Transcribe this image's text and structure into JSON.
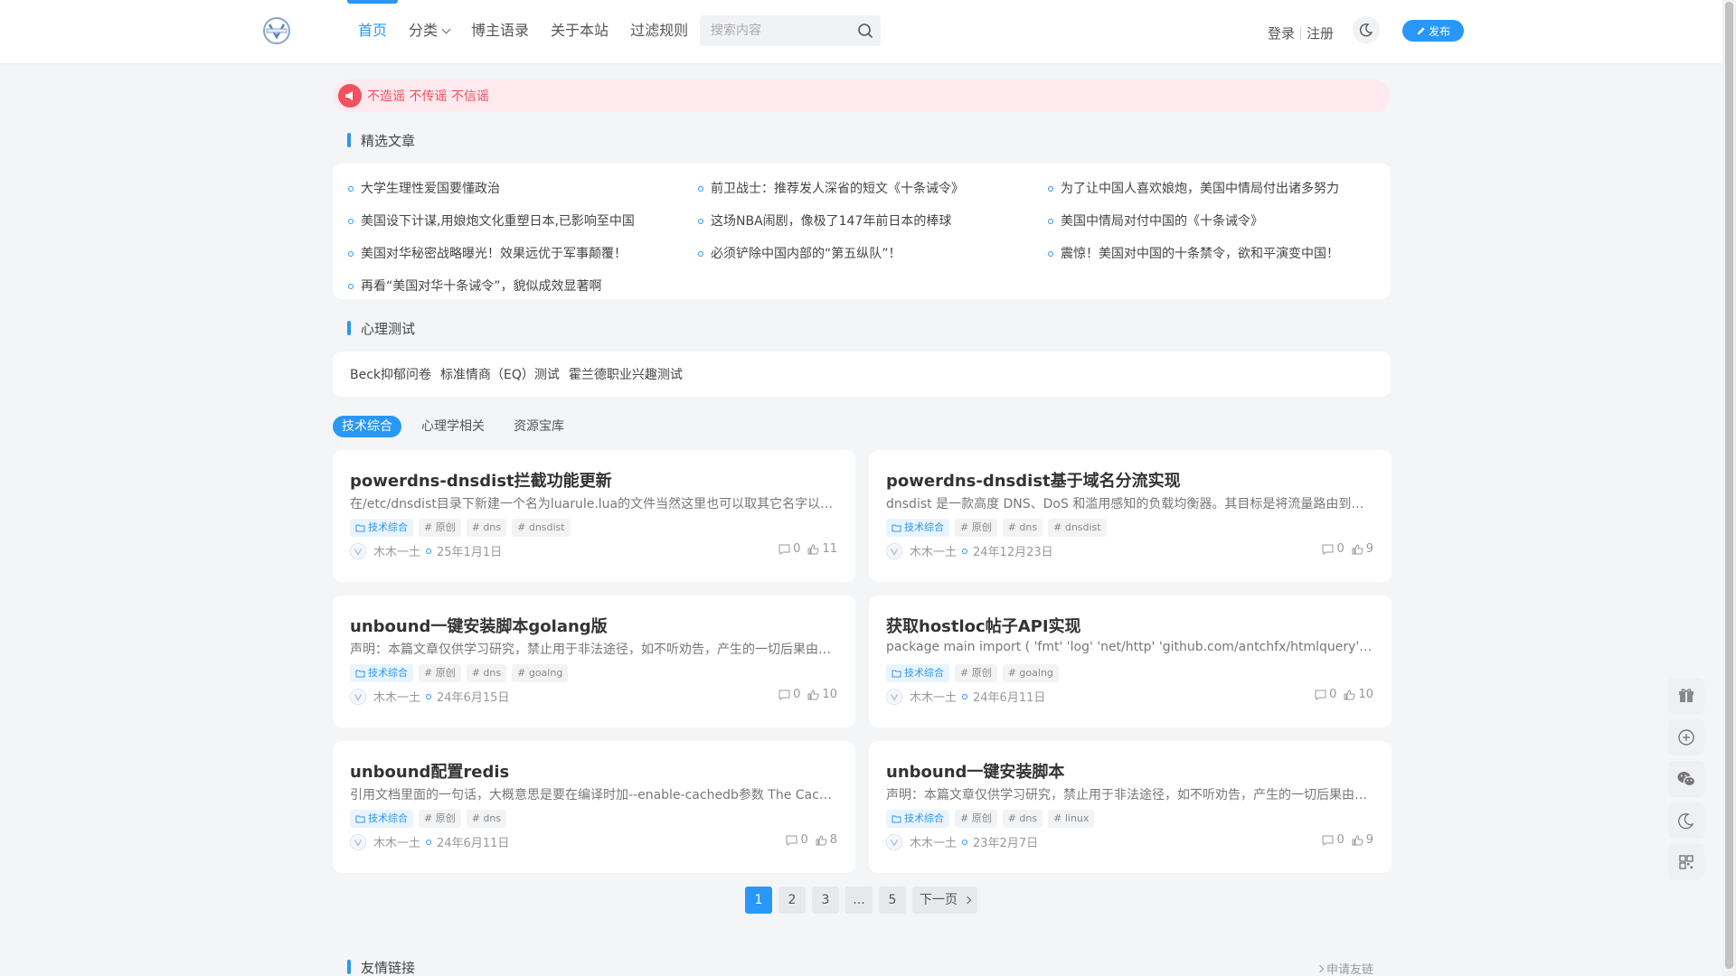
{
  "header": {
    "nav": [
      {
        "label": "首页",
        "active": true
      },
      {
        "label": "分类",
        "dropdown": true
      },
      {
        "label": "博主语录"
      },
      {
        "label": "关于本站"
      },
      {
        "label": "过滤规则"
      }
    ],
    "search_placeholder": "搜索内容",
    "login": "登录",
    "register": "注册",
    "publish": "发布"
  },
  "notice": "不造谣 不传谣 不信谣",
  "featured": {
    "title": "精选文章",
    "items": [
      "大学生理性爱国要懂政治",
      "前卫战士：推荐发人深省的短文《十条诫令》",
      "为了让中国人喜欢娘炮，美国中情局付出诸多努力",
      "美国设下计谋,用娘炮文化重塑日本,已影响至中国",
      "这场NBA闹剧，像极了147年前日本的棒球",
      "美国中情局对付中国的《十条诫令》",
      "美国对华秘密战略曝光！效果远优于军事颠覆！",
      "必须铲除中国内部的“第五纵队”！",
      "震惊！美国对中国的十条禁令，欲和平演变中国！",
      "再看“美国对华十条诫令”，貌似成效显著啊"
    ]
  },
  "psych": {
    "title": "心理测试",
    "links": [
      "Beck抑郁问卷",
      "标准情商（EQ）测试",
      "霍兰德职业兴趣测试"
    ]
  },
  "tabs": [
    {
      "label": "技术综合",
      "active": true
    },
    {
      "label": "心理学相关"
    },
    {
      "label": "资源宝库"
    }
  ],
  "posts": [
    {
      "title": "powerdns-dnsdist拦截功能更新",
      "excerpt": "在/etc/dnsdist目录下新建一个名为luarule.lua的文件当然这里也可以取其它名字以下是对该脚本功能的详细说明",
      "category": "技术综合",
      "tags": [
        "# 原创",
        "# dns",
        "# dnsdist"
      ],
      "author": "木木一土",
      "date": "25年1月1日",
      "comments": "0",
      "likes": "11"
    },
    {
      "title": "powerdns-dnsdist基于域名分流实现",
      "excerpt": "dnsdist 是一款高度 DNS、DoS 和滥用感知的负载均衡器。其目标是将流量路由到最佳服务器",
      "category": "技术综合",
      "tags": [
        "# 原创",
        "# dns",
        "# dnsdist"
      ],
      "author": "木木一土",
      "date": "24年12月23日",
      "comments": "0",
      "likes": "9"
    },
    {
      "title": "unbound一键安装脚本golang版",
      "excerpt": "声明：本篇文章仅供学习研究，禁止用于非法途径，如不听劝告，产生的一切后果由使用者自行承担",
      "category": "技术综合",
      "tags": [
        "# 原创",
        "# dns",
        "# goalng"
      ],
      "author": "木木一土",
      "date": "24年6月15日",
      "comments": "0",
      "likes": "10"
    },
    {
      "title": "获取hostloc帖子API实现",
      "excerpt": "    package main import ( 'fmt' 'log' 'net/http' 'github.com/antchfx/htmlquery' 'github.com/gin-gonic/gin'",
      "category": "技术综合",
      "tags": [
        "# 原创",
        "# goalng"
      ],
      "author": "木木一土",
      "date": "24年6月11日",
      "comments": "0",
      "likes": "10"
    },
    {
      "title": "unbound配置redis",
      "excerpt": "引用文档里面的一句话，大概意思是要在编译时加--enable-cachedb参数 The Cache DB module must be",
      "category": "技术综合",
      "tags": [
        "# 原创",
        "# dns"
      ],
      "author": "木木一土",
      "date": "24年6月11日",
      "comments": "0",
      "likes": "8"
    },
    {
      "title": "unbound一键安装脚本",
      "excerpt": "声明：本篇文章仅供学习研究，禁止用于非法途径，如不听劝告，产生的一切后果由使用者自行承担",
      "category": "技术综合",
      "tags": [
        "# 原创",
        "# dns",
        "# linux"
      ],
      "author": "木木一土",
      "date": "23年2月7日",
      "comments": "0",
      "likes": "9"
    }
  ],
  "pager": {
    "pages": [
      "1",
      "2",
      "3",
      "...",
      "5"
    ],
    "next": "下一页"
  },
  "friends": {
    "title": "友情链接",
    "apply": "申请友链"
  },
  "colors": {
    "accent": "#2997f7",
    "notice": "#f0515f"
  }
}
